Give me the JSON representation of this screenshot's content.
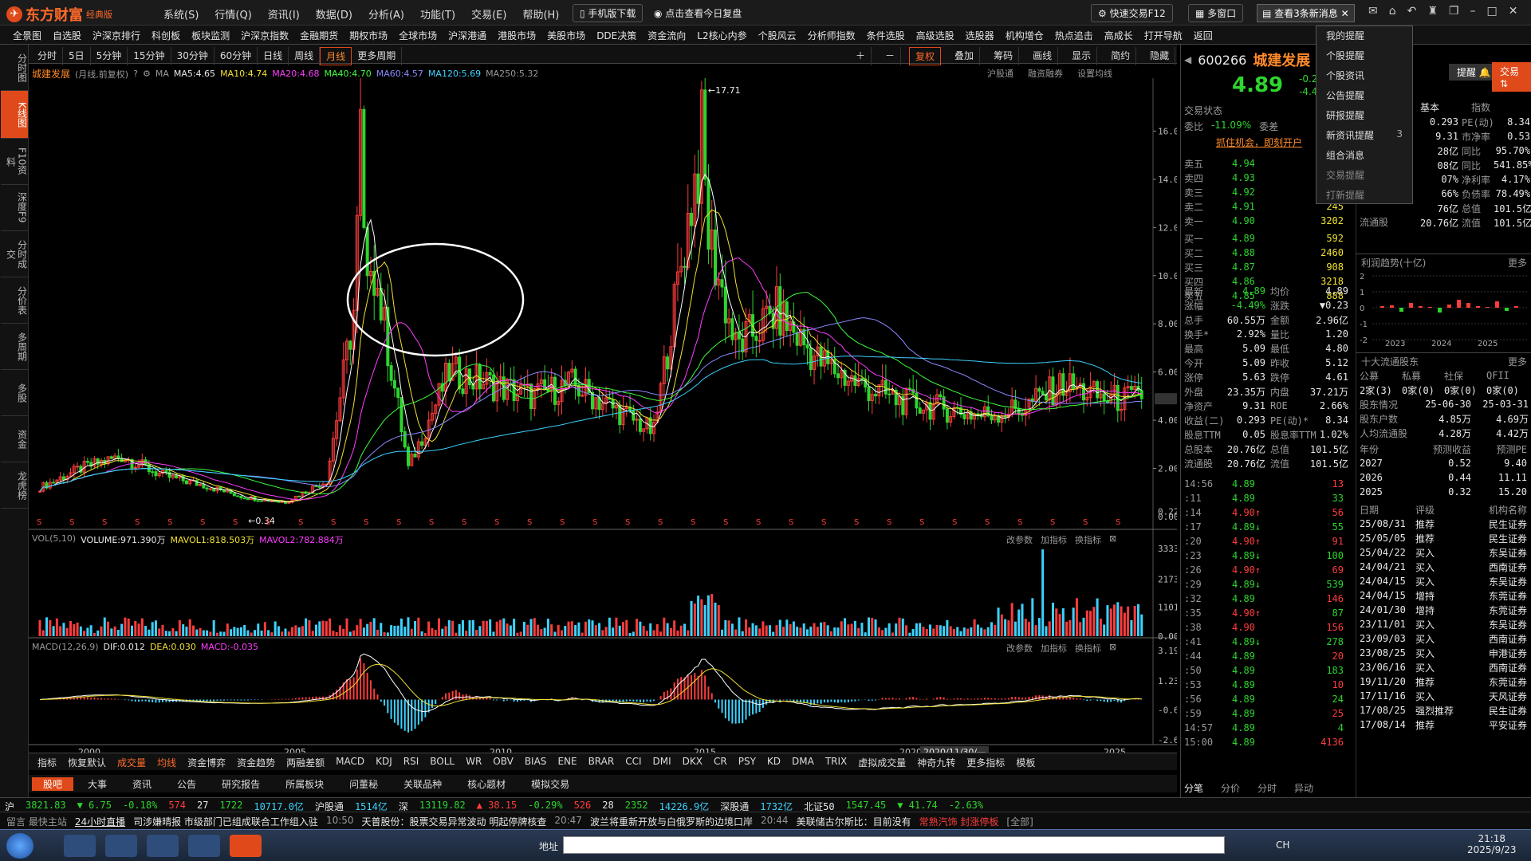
{
  "app": {
    "logo": "东方财富",
    "edition": "经典版"
  },
  "menu": [
    "系统(S)",
    "行情(Q)",
    "资讯(I)",
    "数据(D)",
    "分析(A)",
    "功能(T)",
    "交易(E)",
    "帮助(H)"
  ],
  "top_buttons": {
    "mobile": "手机版下载",
    "review": "点击查看今日复盘",
    "trade": "快速交易F12",
    "multi": "多窗口",
    "notice": "查看3条新消息"
  },
  "nav": [
    "全景图",
    "自选股",
    "沪深京排行",
    "科创板",
    "板块监测",
    "沪深京指数",
    "金融期货",
    "期权市场",
    "全球市场",
    "沪深港通",
    "港股市场",
    "美股市场",
    "DDE决策",
    "资金流向",
    "L2核心内参",
    "个股风云",
    "分析师指数",
    "条件选股",
    "高级选股",
    "选股器",
    "机构增仓",
    "热点追击",
    "高成长",
    "打开导航",
    "返回"
  ],
  "left_tabs": [
    "分时图",
    "K线图",
    "F10资料",
    "深度F9",
    "分时成交",
    "分价表",
    "多周期",
    "多股",
    "资金",
    "龙虎榜"
  ],
  "periods": [
    "分时",
    "5日",
    "5分钟",
    "15分钟",
    "30分钟",
    "60分钟",
    "日线",
    "周线",
    "月线",
    "更多周期"
  ],
  "chart_tools": [
    "复权",
    "叠加",
    "筹码",
    "画线",
    "显示",
    "简约",
    "隐藏"
  ],
  "chart_links": [
    "沪股通",
    "融资融券",
    "设置均线"
  ],
  "main_legend": {
    "name": "城建发展",
    "mode": "(月线,前复权)",
    "ma5": "MA5:4.65",
    "ma10": "MA10:4.74",
    "ma20": "MA20:4.68",
    "ma40": "MA40:4.70",
    "ma60": "MA60:4.57",
    "ma120": "MA120:5.69",
    "ma250": "MA250:5.32"
  },
  "vol_legend": {
    "title": "VOL(5,10)",
    "volume": "VOLUME:971.390万",
    "mavol1": "MAVOL1:818.503万",
    "mavol2": "MAVOL2:782.884万"
  },
  "macd_legend": {
    "title": "MACD(12,26,9)",
    "dif": "DIF:0.012",
    "dea": "DEA:0.030",
    "macd": "MACD:-0.035"
  },
  "sub_links": [
    "改参数",
    "加指标",
    "换指标"
  ],
  "price_axis": [
    "16.00",
    "14.00",
    "12.00",
    "10.00",
    "8.00",
    "6.00",
    "4.00",
    "2.00",
    "0.22",
    "0.00"
  ],
  "vol_axis": [
    "3333.00",
    "2173.00",
    "1101.00",
    "0.00"
  ],
  "macd_axis": [
    "3.19",
    "1.23",
    "-0.67",
    "-2.62"
  ],
  "x_axis": [
    "2000",
    "2005",
    "2010",
    "2015",
    "2020",
    "2020/11/30/—",
    "2025"
  ],
  "annotations": {
    "high": "17.71",
    "low": "0.34"
  },
  "indicators": [
    "指标",
    "恢复默认",
    "成交量",
    "均线",
    "资金博弈",
    "资金趋势",
    "两融差额",
    "MACD",
    "KDJ",
    "RSI",
    "BOLL",
    "WR",
    "OBV",
    "BIAS",
    "ENE",
    "BRAR",
    "CCI",
    "DMI",
    "DKX",
    "CR",
    "PSY",
    "KD",
    "DMA",
    "TRIX",
    "虚拟成交量",
    "神奇九转",
    "更多指标",
    "模板"
  ],
  "news_tabs": [
    "股吧",
    "大事",
    "资讯",
    "公告",
    "研究报告",
    "所属板块",
    "问董秘",
    "关联品种",
    "核心题材",
    "模拟交易"
  ],
  "quote": {
    "code": "600266",
    "name": "城建发展",
    "price": "4.89",
    "change": "-0.23",
    "pct": "-4.49%",
    "alert": "提醒",
    "trade": "交易",
    "status": "交易状态",
    "wb": "委比",
    "wb_val": "-11.09%",
    "wc": "委差",
    "promo": "抓住机会，即刻开户"
  },
  "asks": [
    [
      "卖五",
      "4.94",
      "99"
    ],
    [
      "卖四",
      "4.93",
      "160"
    ],
    [
      "卖三",
      "4.92",
      "182"
    ],
    [
      "卖二",
      "4.91",
      "245"
    ],
    [
      "卖一",
      "4.90",
      "3202"
    ]
  ],
  "bids": [
    [
      "买一",
      "4.89",
      "592"
    ],
    [
      "买二",
      "4.88",
      "2460"
    ],
    [
      "买三",
      "4.87",
      "908"
    ],
    [
      "买四",
      "4.86",
      "3218"
    ],
    [
      "买五",
      "4.85",
      "888"
    ]
  ],
  "stats": [
    [
      "最新",
      "4.89",
      "均价",
      "4.89"
    ],
    [
      "涨幅",
      "-4.49%",
      "涨跌",
      "▼0.23"
    ],
    [
      "总手",
      "60.55万",
      "金额",
      "2.96亿"
    ],
    [
      "换手*",
      "2.92%",
      "量比",
      "1.20"
    ],
    [
      "最高",
      "5.09",
      "最低",
      "4.80"
    ],
    [
      "今开",
      "5.09",
      "昨收",
      "5.12"
    ],
    [
      "涨停",
      "5.63",
      "跌停",
      "4.61"
    ],
    [
      "外盘",
      "23.35万",
      "内盘",
      "37.21万"
    ],
    [
      "净资产",
      "9.31",
      "ROE",
      "2.66%"
    ],
    [
      "收益(二)",
      "0.293",
      "PE(动)*",
      "8.34"
    ],
    [
      "股息TTM",
      "0.05",
      "股息率TTM",
      "1.02%"
    ],
    [
      "总股本",
      "20.76亿",
      "总值",
      "101.5亿"
    ],
    [
      "流通股",
      "20.76亿",
      "流值",
      "101.5亿"
    ]
  ],
  "ticks": [
    [
      "14:56",
      "4.89",
      "13"
    ],
    [
      ":11",
      "4.89",
      "33"
    ],
    [
      ":14",
      "4.90↑",
      "56"
    ],
    [
      ":17",
      "4.89↓",
      "55"
    ],
    [
      ":20",
      "4.90↑",
      "91"
    ],
    [
      ":23",
      "4.89↓",
      "100"
    ],
    [
      ":26",
      "4.90↑",
      "69"
    ],
    [
      ":29",
      "4.89↓",
      "539"
    ],
    [
      ":32",
      "4.89",
      "146"
    ],
    [
      ":35",
      "4.90↑",
      "87"
    ],
    [
      ":38",
      "4.90",
      "156"
    ],
    [
      ":41",
      "4.89↓",
      "278"
    ],
    [
      ":44",
      "4.89",
      "20"
    ],
    [
      ":50",
      "4.89",
      "183"
    ],
    [
      ":53",
      "4.89",
      "10"
    ],
    [
      ":56",
      "4.89",
      "24"
    ],
    [
      ":59",
      "4.89",
      "25"
    ],
    [
      "14:57",
      "4.89",
      "4"
    ],
    [
      "15:00",
      "4.89",
      "4136"
    ]
  ],
  "tick_tabs": [
    "分笔",
    "分价",
    "分时",
    "异动"
  ],
  "fund_tabs": [
    "基本",
    "指数"
  ],
  "fund": [
    [
      "0.293",
      "PE(动)",
      "8.34"
    ],
    [
      "9.31",
      "市净率",
      "0.53"
    ],
    [
      "28亿",
      "同比",
      "95.70%"
    ],
    [
      "08亿",
      "同比",
      "541.85%"
    ],
    [
      "07%",
      "净利率",
      "4.17%"
    ],
    [
      "66%",
      "负债率",
      "78.49%"
    ],
    [
      "76亿",
      "总值",
      "101.5亿"
    ],
    [
      "20.76亿",
      "流值",
      "101.5亿"
    ]
  ],
  "fund_first_label": "流通股",
  "profit": {
    "title": "利润趋势(十亿)",
    "more": "更多",
    "years": [
      "2023",
      "2024",
      "2025"
    ],
    "yaxis": [
      "2",
      "1",
      "0",
      "-1",
      "-2"
    ],
    "values": [
      0.1,
      0.15,
      -0.25,
      0.3,
      0.1,
      0.05,
      -0.3,
      0.2,
      0.5,
      0.3,
      0.1,
      0.05,
      0.4,
      -0.2,
      0.1
    ]
  },
  "holders": {
    "title": "十大流通股东",
    "more": "更多",
    "cols": [
      "公募",
      "私募",
      "社保",
      "QFII"
    ],
    "vals": [
      "2家(3)",
      "0家(0)",
      "0家(0)",
      "0家(0)"
    ],
    "r1": [
      "股东情况",
      "25-06-30",
      "25-03-31"
    ],
    "r2": [
      "股东户数",
      "4.85万",
      "4.69万"
    ],
    "r3": [
      "人均流通股",
      "4.28万",
      "4.42万"
    ]
  },
  "forecast": {
    "cols": [
      "年份",
      "预测收益",
      "预测PE"
    ],
    "rows": [
      [
        "2027",
        "0.52",
        "9.40"
      ],
      [
        "2026",
        "0.44",
        "11.11"
      ],
      [
        "2025",
        "0.32",
        "15.20"
      ]
    ]
  },
  "ratings": {
    "cols": [
      "日期",
      "评级",
      "机构名称"
    ],
    "rows": [
      [
        "25/08/31",
        "推荐",
        "民生证券"
      ],
      [
        "25/05/05",
        "推荐",
        "民生证券"
      ],
      [
        "25/04/22",
        "买入",
        "东吴证券"
      ],
      [
        "24/04/21",
        "买入",
        "西南证券"
      ],
      [
        "24/04/15",
        "买入",
        "东吴证券"
      ],
      [
        "24/04/15",
        "增持",
        "东莞证券"
      ],
      [
        "24/01/30",
        "增持",
        "东莞证券"
      ],
      [
        "23/11/01",
        "买入",
        "东吴证券"
      ],
      [
        "23/09/03",
        "买入",
        "西南证券"
      ],
      [
        "23/08/25",
        "买入",
        "申港证券"
      ],
      [
        "23/06/16",
        "买入",
        "西南证券"
      ],
      [
        "19/11/20",
        "推荐",
        "东莞证券"
      ],
      [
        "17/11/16",
        "买入",
        "天风证券"
      ],
      [
        "17/08/25",
        "强烈推荐",
        "民生证券"
      ],
      [
        "17/08/14",
        "推荐",
        "平安证券"
      ]
    ]
  },
  "dropdown": [
    "我的提醒",
    "个股提醒",
    "个股资讯",
    "公告提醒",
    "研报提醒",
    "新资讯提醒",
    "组合消息",
    "交易提醒",
    "打新提醒"
  ],
  "dropdown_badge": "3",
  "status": {
    "sh": "沪",
    "sh_idx": "3821.83",
    "sh_chg": "▼ 6.75",
    "sh_pct": "-0.18%",
    "sh_up": "574",
    "sh_flat": "27",
    "sh_down": "1722",
    "sh_amt": "10717.0亿",
    "hgt": "沪股通",
    "hgt_val": "1514亿",
    "sz": "深",
    "sz_idx": "13119.82",
    "sz_chg": "▲ 38.15",
    "sz_pct": "-0.29%",
    "sz_up": "526",
    "sz_flat": "28",
    "sz_down": "2352",
    "sz_amt": "14226.9亿",
    "sgt": "深股通",
    "sgt_val": "1732亿",
    "bz": "北证50",
    "bz_idx": "1547.45",
    "bz_chg": "▼ 41.74",
    "bz_pct": "-2.63%"
  },
  "ticker": {
    "left": "留言 最快主站",
    "live": "24小时直播",
    "t1": "司涉嫌晴报 市级部门已组成联合工作组入驻",
    "time1": "10:50",
    "t2": "天普股份：股票交易异常波动 明起停牌核查",
    "time2": "20:47",
    "t3": "波兰将重新开放与白俄罗斯的边境口岸",
    "time3": "20:44",
    "t4": "美联储古尔斯比：目前没有",
    "t5": "常熟汽饰 封涨停板",
    "all": "[全部]"
  },
  "taskbar": {
    "address": "地址",
    "time": "21:18",
    "date": "2025/9/23",
    "lang": "CH"
  },
  "colors": {
    "up": "#ff3c3c",
    "down": "#2ed52e",
    "accent": "#e04a1a",
    "ma5": "#ffffff",
    "ma10": "#f0e030",
    "ma20": "#ff3cff",
    "ma40": "#3cff3c",
    "ma60": "#8a8aff",
    "ma120": "#3cd2ff",
    "ma250": "#aaaaaa"
  },
  "chart_data": {
    "type": "candlestick",
    "title": "城建发展",
    "period": "月线",
    "yrange": [
      0,
      18
    ],
    "key_points": {
      "high": 17.71,
      "low": 0.34,
      "latest": 4.89
    },
    "x": [
      "1999",
      "2000",
      "2001",
      "2002",
      "2003",
      "2004",
      "2005",
      "2006",
      "2007",
      "2008",
      "2009",
      "2010",
      "2011",
      "2012",
      "2013",
      "2014",
      "2015",
      "2016",
      "2017",
      "2018",
      "2019",
      "2020",
      "2021",
      "2022",
      "2023",
      "2024",
      "2025"
    ],
    "close_approx": [
      1.2,
      2.0,
      2.5,
      1.7,
      1.3,
      0.8,
      0.6,
      1.5,
      12.0,
      2.0,
      6.0,
      5.5,
      5.0,
      5.5,
      4.5,
      3.5,
      14.0,
      7.0,
      8.5,
      6.5,
      5.5,
      4.8,
      4.5,
      4.2,
      4.5,
      5.5,
      4.89
    ],
    "macd_range": [
      -2.62,
      3.19
    ],
    "volume_max": 3333
  }
}
